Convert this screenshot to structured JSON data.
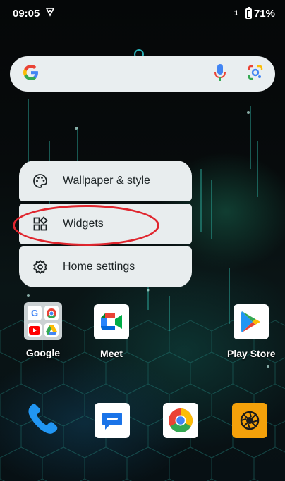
{
  "status_bar": {
    "time": "09:05",
    "sim": "1",
    "battery": "71%"
  },
  "search": {
    "logo_icon": "google-g-icon",
    "mic_icon": "microphone-icon",
    "lens_icon": "google-lens-icon"
  },
  "menu": {
    "items": [
      {
        "label": "Wallpaper & style",
        "icon": "palette-icon"
      },
      {
        "label": "Widgets",
        "icon": "widgets-icon"
      },
      {
        "label": "Home settings",
        "icon": "gear-icon"
      }
    ]
  },
  "apps": {
    "google_folder": {
      "label": "Google"
    },
    "meet": {
      "label": "Meet"
    },
    "play_store": {
      "label": "Play Store"
    }
  },
  "dock": [
    "phone-icon",
    "messages-icon",
    "chrome-icon",
    "camera-shutter-icon"
  ],
  "colors": {
    "menu_bg": "#e8edee",
    "annotation": "#e0262e",
    "accent": "#2ab0b8"
  }
}
